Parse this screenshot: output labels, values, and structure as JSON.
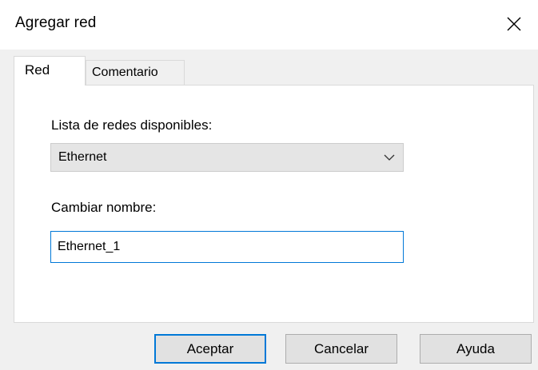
{
  "window": {
    "title": "Agregar red"
  },
  "tabs": [
    {
      "label": "Red",
      "active": true
    },
    {
      "label": "Comentario",
      "active": false
    }
  ],
  "form": {
    "networks_label": "Lista de redes disponibles:",
    "network_selected": "Ethernet",
    "rename_label": "Cambiar nombre:",
    "rename_value": "Ethernet_1"
  },
  "buttons": {
    "accept": "Aceptar",
    "cancel": "Cancelar",
    "help": "Ayuda"
  },
  "icons": {
    "close": "close-icon",
    "dropdown": "chevron-down-icon"
  },
  "colors": {
    "focus_accent": "#0078d7",
    "dialog_background": "#f0f0f0",
    "button_background": "#e1e1e1"
  }
}
